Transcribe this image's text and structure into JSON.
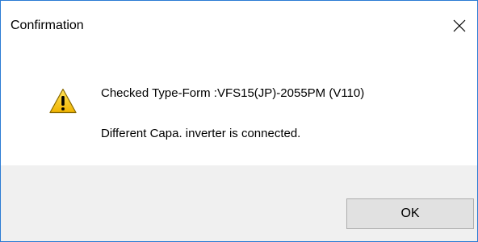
{
  "window": {
    "title": "Confirmation",
    "close_icon": "close-icon",
    "border_color": "#2b7bd4"
  },
  "message": {
    "icon": "warning-icon",
    "line1": "Checked Type-Form :VFS15(JP)-2055PM (V110)",
    "line2": "Different Capa. inverter is connected."
  },
  "buttons": {
    "ok_label": "OK"
  },
  "colors": {
    "content_bg": "#ffffff",
    "footer_bg": "#f0f0f0",
    "button_bg": "#e1e1e1",
    "warning_yellow": "#f2c400"
  }
}
